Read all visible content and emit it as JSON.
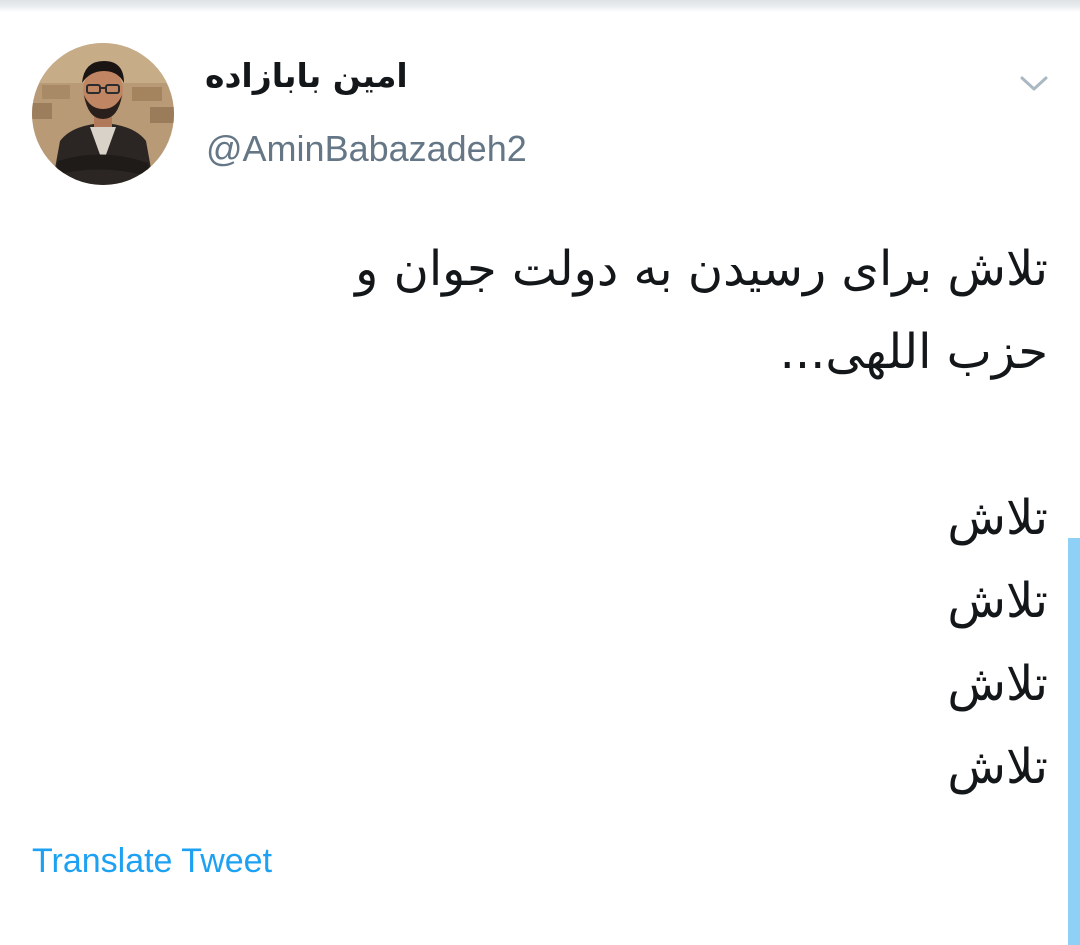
{
  "tweet": {
    "author": {
      "display_name": "امین بابازاده",
      "handle": "@AminBabazadeh2"
    },
    "text_lines": [
      "تلاش برای رسیدن به دولت جوان و",
      "حزب اللهی...",
      "",
      "تلاش",
      "تلاش",
      "تلاش",
      "تلاش"
    ],
    "translate_label": "Translate Tweet"
  },
  "icons": {
    "menu_caret": "chevron-down-icon",
    "avatar": "profile-photo"
  },
  "colors": {
    "text_primary": "#14171a",
    "text_secondary": "#657786",
    "link": "#1da1f2",
    "scrollbar": "#8ed0f6"
  }
}
